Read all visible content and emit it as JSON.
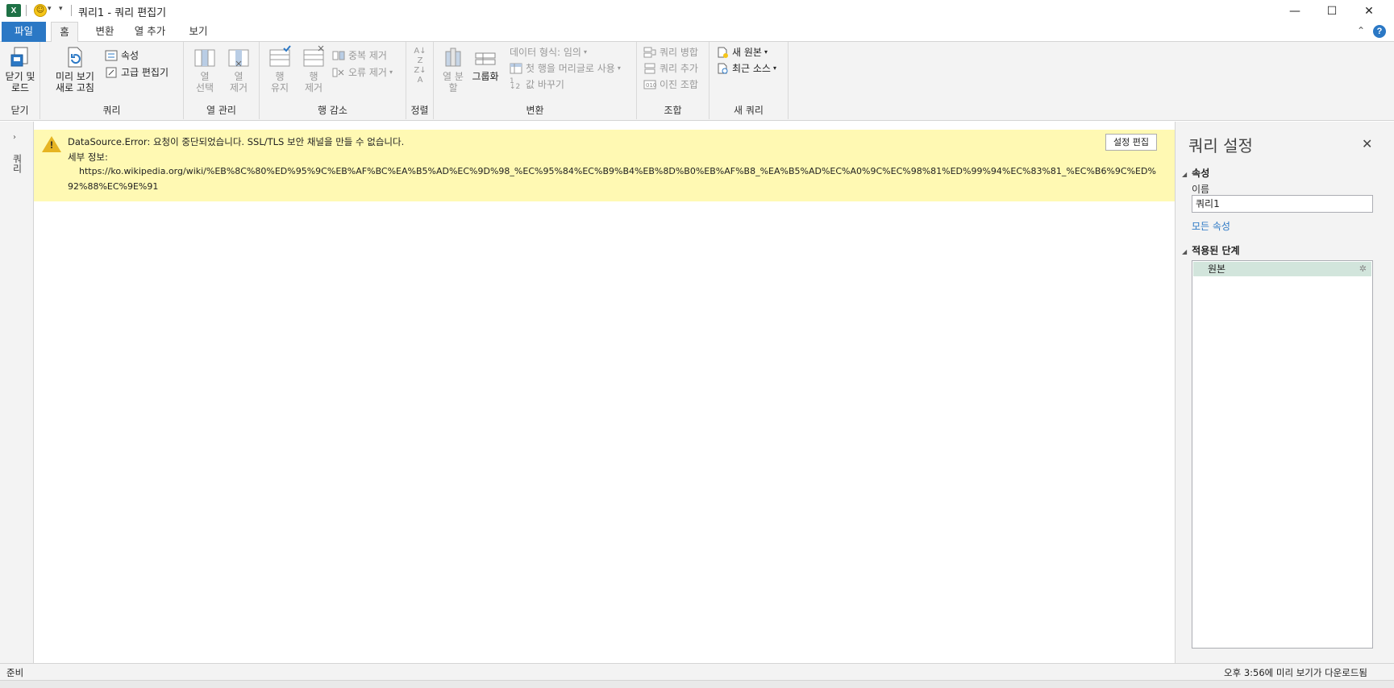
{
  "titlebar": {
    "title": "쿼리1 - 쿼리 편집기",
    "minimize": "—",
    "maximize": "☐",
    "close": "✕"
  },
  "tabs": {
    "file": "파일",
    "home": "홈",
    "transform": "변환",
    "add_column": "열 추가",
    "view": "보기"
  },
  "ribbon": {
    "close": {
      "close_load": "닫기 및 로드",
      "label": "닫기"
    },
    "query": {
      "refresh_preview": "미리 보기 새로 고침",
      "properties": "속성",
      "advanced_editor": "고급 편집기",
      "label": "쿼리"
    },
    "manage_columns": {
      "choose_columns": "열 선택",
      "remove_columns": "열 제거",
      "label": "열 관리"
    },
    "reduce_rows": {
      "keep_rows": "행 유지",
      "remove_rows": "행 제거",
      "remove_duplicates": "중복 제거",
      "remove_errors": "오류 제거",
      "label": "행 감소"
    },
    "sort": {
      "label": "정렬"
    },
    "transform": {
      "split_column": "열 분할",
      "group_by": "그룹화",
      "data_type": "데이터 형식: 임의",
      "use_first_row": "첫 행을 머리글로 사용",
      "replace_values": "값 바꾸기",
      "label": "변환"
    },
    "combine": {
      "merge_queries": "쿼리 병합",
      "append_queries": "쿼리 추가",
      "combine_binaries": "이진 조합",
      "label": "조합"
    },
    "new_query": {
      "new_source": "새 원본",
      "recent_sources": "최근 소스",
      "label": "새 쿼리"
    }
  },
  "left_pane": {
    "label": "쿼리"
  },
  "error": {
    "message": "DataSource.Error: 요청이 중단되었습니다. SSL/TLS 보안 채널을 만들 수 없습니다.",
    "details_label": "세부 정보:",
    "url_line1": "https://ko.wikipedia.org/wiki/%EB%8C%80%ED%95%9C%EB%AF%BC%EA%B5%AD%EC%9D%98_%EC%95%84%EC%B9%B4%EB%8D%B0%EB%AF%B8_%EA%B5%AD%EC%A0%9C%EC%98%81%ED%99%94%EC%83%81_%EC%B6%9C%ED%",
    "url_line2": "92%88%EC%9E%91",
    "edit_settings": "설정 편집"
  },
  "query_settings": {
    "title": "쿼리 설정",
    "properties_section": "속성",
    "name_label": "이름",
    "name_value": "쿼리1",
    "all_properties": "모든 속성",
    "applied_steps_section": "적용된 단계",
    "steps": [
      "원본"
    ]
  },
  "status": {
    "left": "준비",
    "right": "오후 3:56에 미리 보기가 다운로드됨"
  }
}
